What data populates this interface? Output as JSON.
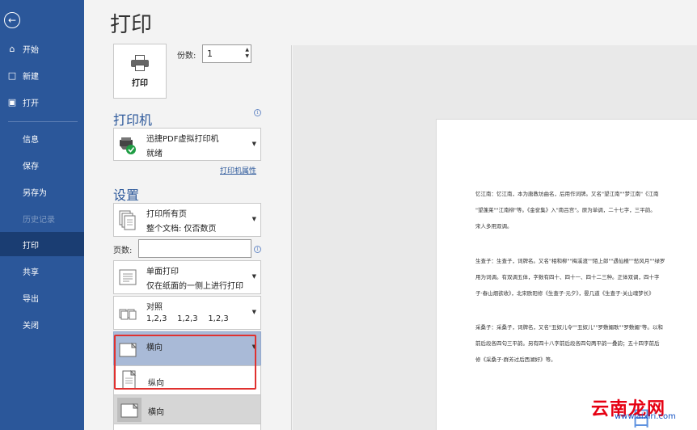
{
  "sidebar": {
    "items": [
      {
        "label": "开始",
        "icon": "home-icon"
      },
      {
        "label": "新建",
        "icon": "new-doc-icon"
      },
      {
        "label": "打开",
        "icon": "open-folder-icon"
      },
      {
        "label": "信息"
      },
      {
        "label": "保存"
      },
      {
        "label": "另存为"
      },
      {
        "label": "历史记录"
      },
      {
        "label": "打印"
      },
      {
        "label": "共享"
      },
      {
        "label": "导出"
      },
      {
        "label": "关闭"
      }
    ],
    "active": "打印"
  },
  "title": "打印",
  "print_button": {
    "label": "打印"
  },
  "copies": {
    "label": "份数:",
    "value": "1"
  },
  "printer": {
    "section": "打印机",
    "name": "迅捷PDF虚拟打印机",
    "status": "就绪",
    "properties_link": "打印机属性"
  },
  "settings": {
    "section": "设置",
    "range": {
      "line1": "打印所有页",
      "line2": "整个文档: 仅否数页"
    },
    "pages_label": "页数:",
    "sides": {
      "line1": "单面打印",
      "line2": "仅在纸面的一侧上进行打印"
    },
    "collate": {
      "line1": "对照",
      "line2": "1,2,3    1,2,3    1,2,3"
    },
    "orientation": {
      "selected": "横向",
      "options": [
        "纵向",
        "横向"
      ]
    }
  },
  "preview": {
    "lines": [
      "忆江南：忆江南，本为唐教坊曲名，后用作词牌。又名\"望江南\"\"梦江南\"《江南",
      "\"望蓬莱\"\"江南柳\"等。《金奁集》入\"南吕宫\"。原为单调，二十七字，三平韵。",
      "宋人多用双调。",
      "生查子：生查子，词牌名。又名\"相和柳\"\"梅溪渡\"\"陌上郎\"\"遇仙楂\"\"愁风月\"\"绿罗",
      "用为词调。有双调五体，字数有四十、四十一、四十二三种。正体双调，四十字",
      "子·春山烟欲收》，北宋欧阳修《生查子·元夕》，晏几道《生查子·关山魂梦长》",
      "采桑子：采桑子，词牌名，又名\"丑奴儿令\"\"丑奴儿\"\"罗敷媚歌\"\"罗敷媚\"等。以和",
      "前后段各四句三平韵。另有四十八字前后段各四句两平韵一叠韵；五十四字前后",
      "修《采桑子·群芳过后西湖好》等。"
    ]
  },
  "watermark": {
    "brand": "云南龙网",
    "url": "www.aixiri.com",
    "big": "日"
  }
}
